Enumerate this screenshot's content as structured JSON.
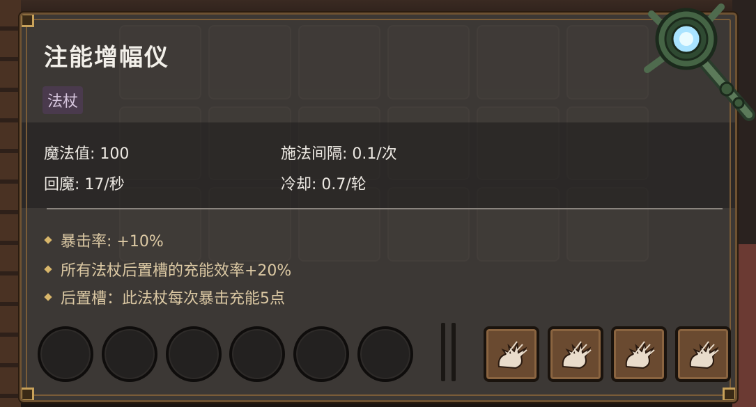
{
  "item": {
    "name": "注能增幅仪",
    "type_tag": "法杖",
    "icon": "magic-staff-icon"
  },
  "stats": {
    "mana": "魔法值: 100",
    "cast_interval": "施法间隔: 0.1/次",
    "mana_regen": "回魔: 17/秒",
    "cooldown": "冷却: 0.7/轮"
  },
  "effects": [
    "暴击率: +10%",
    "所有法杖后置槽的充能效率+20%",
    "后置槽：此法杖每次暴击充能5点"
  ],
  "slots": {
    "empty_count": 6,
    "rune_icon": "spark-burst-icon",
    "rune_count": 4
  },
  "colors": {
    "title": "#f2efe9",
    "effect_text": "#dcc9a4",
    "tag_bg": "#4a3a4d",
    "frame": "#7a5c38"
  }
}
